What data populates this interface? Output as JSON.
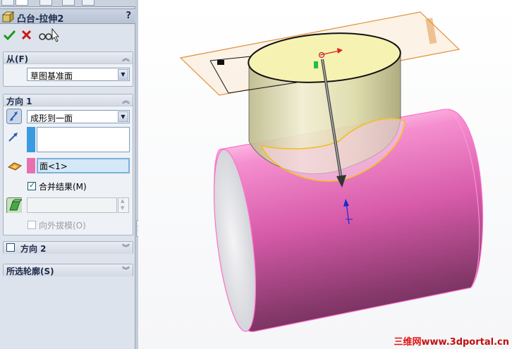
{
  "feature": {
    "title": "凸台-拉伸2",
    "help": "?"
  },
  "actions": {
    "ok": "ok-checkmark-icon",
    "cancel": "cancel-x-icon",
    "preview": "detailed-preview-glasses-icon"
  },
  "from_section": {
    "label": "从(F)",
    "start_condition": "草图基准面"
  },
  "direction1": {
    "label": "方向 1",
    "end_condition": "成形到一面",
    "face_ref": "面<1>",
    "merge_result_label": "合并结果(M)",
    "merge_result_checked": true,
    "draft_outward_label": "向外拔模(O)",
    "draft_outward_checked": false
  },
  "direction2": {
    "label": "方向 2",
    "checked": false
  },
  "selected_contours": {
    "label": "所选轮廓(S)"
  },
  "colors": {
    "accent_blue": "#3a9be0",
    "face_pink": "#e870b0",
    "part_pink": "#e8509f",
    "boss_yellow": "#e8e6b4",
    "plane_orange": "#e0903a"
  },
  "watermark": {
    "site_cn": "三维网",
    "site_url": "www.3dportal.cn"
  }
}
